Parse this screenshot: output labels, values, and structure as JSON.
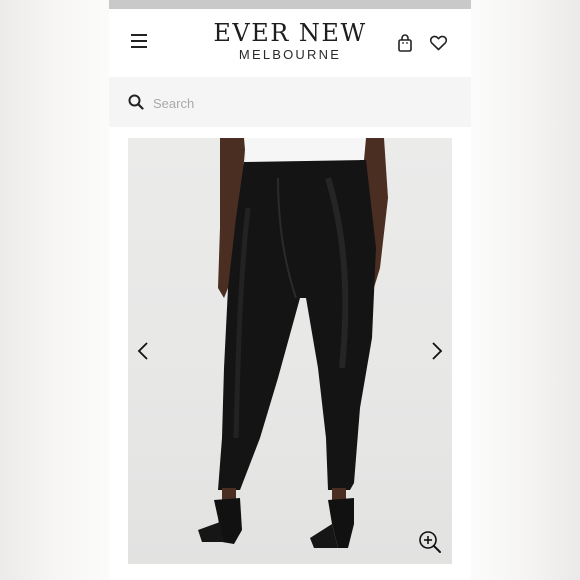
{
  "header": {
    "logo_main": "EVER NEW",
    "logo_sub": "MELBOURNE",
    "menu_icon": "hamburger-menu-icon",
    "bag_icon": "shopping-bag-icon",
    "wishlist_icon": "heart-icon"
  },
  "search": {
    "placeholder": "Search",
    "value": "",
    "icon": "search-icon"
  },
  "product_image": {
    "prev_icon": "chevron-left-icon",
    "next_icon": "chevron-right-icon",
    "zoom_icon": "zoom-in-icon"
  },
  "colors": {
    "accent": "#1e1e1e",
    "search_bg": "#f5f5f5",
    "image_bg": "#e9e9e8"
  }
}
